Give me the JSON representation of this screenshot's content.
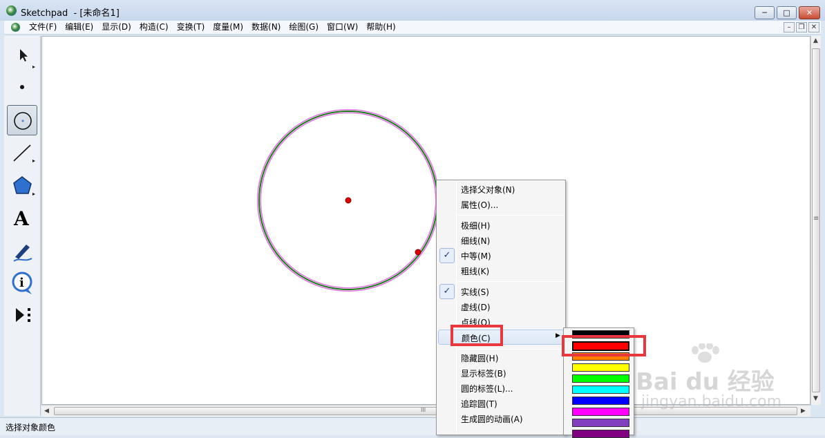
{
  "window": {
    "title": "Sketchpad  - [未命名1]",
    "controls": {
      "minimize": "─",
      "maximize": "□",
      "close": "✕"
    }
  },
  "menubar": {
    "items": [
      "文件(F)",
      "编辑(E)",
      "显示(D)",
      "构造(C)",
      "变换(T)",
      "度量(M)",
      "数据(N)",
      "绘图(G)",
      "窗口(W)",
      "帮助(H)"
    ],
    "mdi_controls": {
      "minimize": "–",
      "restore": "❐",
      "close": "✕"
    }
  },
  "toolbox": {
    "tools": [
      {
        "name": "arrow-select-tool",
        "icon": "arrow-icon",
        "selected": false
      },
      {
        "name": "point-tool",
        "icon": "point-icon",
        "selected": false
      },
      {
        "name": "compass-tool",
        "icon": "circle-icon",
        "selected": true
      },
      {
        "name": "straightedge-tool",
        "icon": "line-icon",
        "selected": false
      },
      {
        "name": "polygon-tool",
        "icon": "polygon-icon",
        "selected": false
      },
      {
        "name": "text-tool",
        "icon": "text-icon",
        "selected": false,
        "glyph": "A"
      },
      {
        "name": "marker-tool",
        "icon": "marker-icon",
        "selected": false
      },
      {
        "name": "info-tool",
        "icon": "info-icon",
        "selected": false,
        "glyph": "i"
      },
      {
        "name": "custom-tool",
        "icon": "play-icon",
        "selected": false
      }
    ]
  },
  "context_menu": {
    "items": [
      {
        "label": "选择父对象(N)",
        "checked": false
      },
      {
        "label": "属性(O)...",
        "checked": false
      },
      {
        "separator": true
      },
      {
        "label": "极细(H)",
        "checked": false
      },
      {
        "label": "细线(N)",
        "checked": false
      },
      {
        "label": "中等(M)",
        "checked": true
      },
      {
        "label": "粗线(K)",
        "checked": false
      },
      {
        "separator": true
      },
      {
        "label": "实线(S)",
        "checked": true
      },
      {
        "label": "虚线(D)",
        "checked": false
      },
      {
        "label": "点线(O)",
        "checked": false
      },
      {
        "label": "颜色(C)",
        "checked": false,
        "submenu": true,
        "hover": true
      },
      {
        "separator": true
      },
      {
        "label": "隐藏圆(H)",
        "checked": false
      },
      {
        "label": "显示标签(B)",
        "checked": false
      },
      {
        "label": "圆的标签(L)...",
        "checked": false
      },
      {
        "label": "追踪圆(T)",
        "checked": false
      },
      {
        "label": "生成圆的动画(A)",
        "checked": false
      }
    ],
    "check_glyph": "✓",
    "submenu_arrow": "▶"
  },
  "color_submenu": {
    "swatches": [
      "#000000",
      "#ff0000",
      "#ff8000",
      "#ffff00",
      "#00ff00",
      "#00ffff",
      "#0000ff",
      "#ff00ff",
      "#8040c0",
      "#800080"
    ],
    "selected_index": 1
  },
  "canvas": {
    "circle": {
      "stroke_color": "#1a7a1a",
      "selection_color": "#e070e0"
    },
    "points": {
      "color": "#e00000"
    }
  },
  "scrollbars": {
    "h_thumb_grip": "III",
    "v_thumb_grip": "≡"
  },
  "statusbar": {
    "text": "选择对象颜色"
  },
  "watermark": {
    "logo": "Bai du 经验",
    "url": "jingyan.baidu.com"
  }
}
